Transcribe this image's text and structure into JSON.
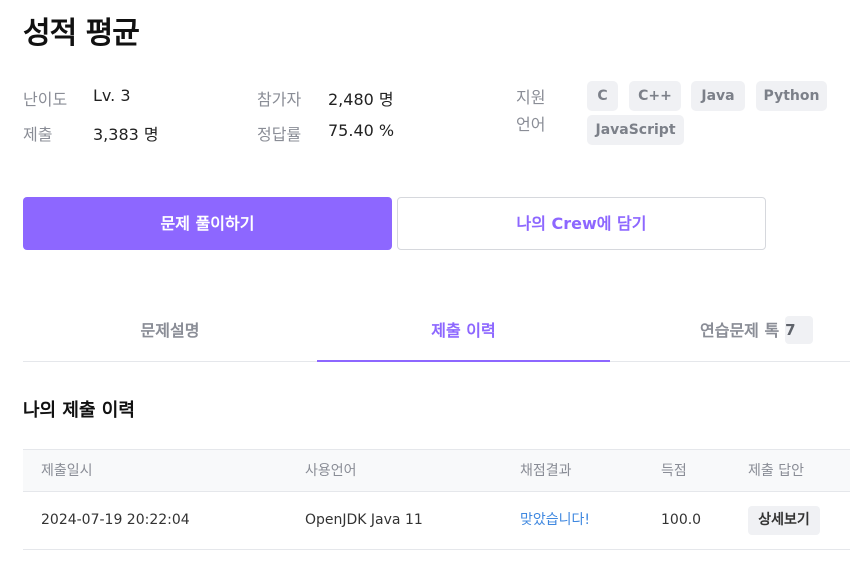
{
  "problem": {
    "title": "성적 평균"
  },
  "stats": {
    "difficulty_label": "난이도",
    "difficulty_value": "Lv. 3",
    "submissions_label": "제출",
    "submissions_value": "3,383 명",
    "participants_label": "참가자",
    "participants_value": "2,480 명",
    "accuracy_label": "정답률",
    "accuracy_value": "75.40 %"
  },
  "languages": {
    "label": "지원 언어",
    "items": [
      "C",
      "C++",
      "Java",
      "Python",
      "JavaScript"
    ]
  },
  "actions": {
    "solve_label": "문제 풀이하기",
    "add_to_crew_label": "나의 Crew에 담기"
  },
  "tabs": [
    {
      "label": "문제설명"
    },
    {
      "label": "제출 이력"
    },
    {
      "label": "연습문제 톡",
      "count": "7"
    }
  ],
  "submission_history": {
    "title": "나의 제출 이력",
    "columns": [
      "제출일시",
      "사용언어",
      "채점결과",
      "득점",
      "제출 답안"
    ],
    "rows": [
      {
        "date": "2024-07-19 20:22:04",
        "language": "OpenJDK Java 11",
        "result": "맞았습니다!",
        "score": "100.0",
        "action_label": "상세보기"
      }
    ]
  },
  "colors": {
    "accent": "#8d67ff",
    "result_ok": "#3f88e0",
    "muted": "#8a8d96"
  }
}
